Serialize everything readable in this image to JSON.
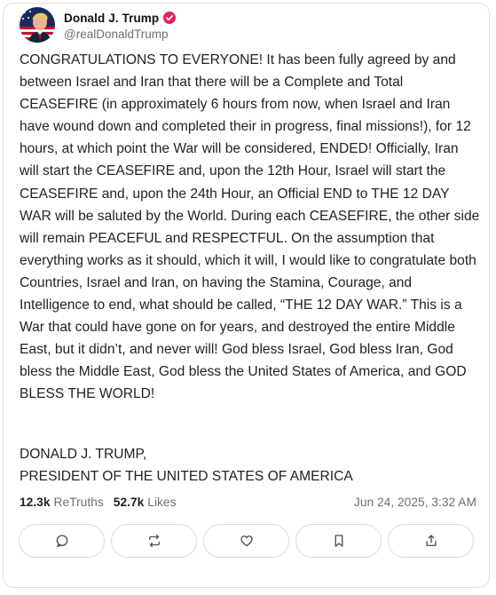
{
  "post": {
    "author": {
      "display_name": "Donald J. Trump",
      "handle": "@realDonaldTrump",
      "verified": true,
      "verified_color": "#e0245e",
      "avatar_icon": "avatar-american-flag-portrait"
    },
    "body": "CONGRATULATIONS TO EVERYONE! It has been fully agreed by and between Israel and Iran that there will be a Complete and Total CEASEFIRE (in approximately 6 hours from now, when Israel and Iran have wound down and completed their in progress, final missions!), for 12 hours, at which point the War will be considered, ENDED! Officially, Iran will start the CEASEFIRE and, upon the 12th Hour, Israel will start the CEASEFIRE and, upon the 24th Hour, an Official END to THE 12 DAY WAR will be saluted by the World. During each CEASEFIRE, the other side will remain PEACEFUL and RESPECTFUL. On the assumption that everything works as it should, which it will, I would like to congratulate both Countries, Israel and Iran, on having the Stamina, Courage, and Intelligence to end, what should be called, “THE 12 DAY WAR.” This is a War that could have gone on for years, and destroyed the entire Middle East, but it didn’t, and never will! God bless Israel, God bless Iran, God bless the Middle East, God bless the United States of America, and GOD BLESS THE WORLD!",
    "signature_line_1": "DONALD J. TRUMP,",
    "signature_line_2": "PRESIDENT OF THE UNITED STATES OF AMERICA",
    "stats": {
      "retruths_count": "12.3k",
      "retruths_label": "ReTruths",
      "likes_count": "52.7k",
      "likes_label": "Likes"
    },
    "timestamp": "Jun 24, 2025, 3:32 AM"
  },
  "actions": [
    {
      "name": "reply",
      "icon": "speech-bubble-icon"
    },
    {
      "name": "retruth",
      "icon": "repost-arrows-icon"
    },
    {
      "name": "like",
      "icon": "heart-icon"
    },
    {
      "name": "bookmark",
      "icon": "bookmark-icon"
    },
    {
      "name": "share",
      "icon": "share-upload-icon"
    }
  ]
}
